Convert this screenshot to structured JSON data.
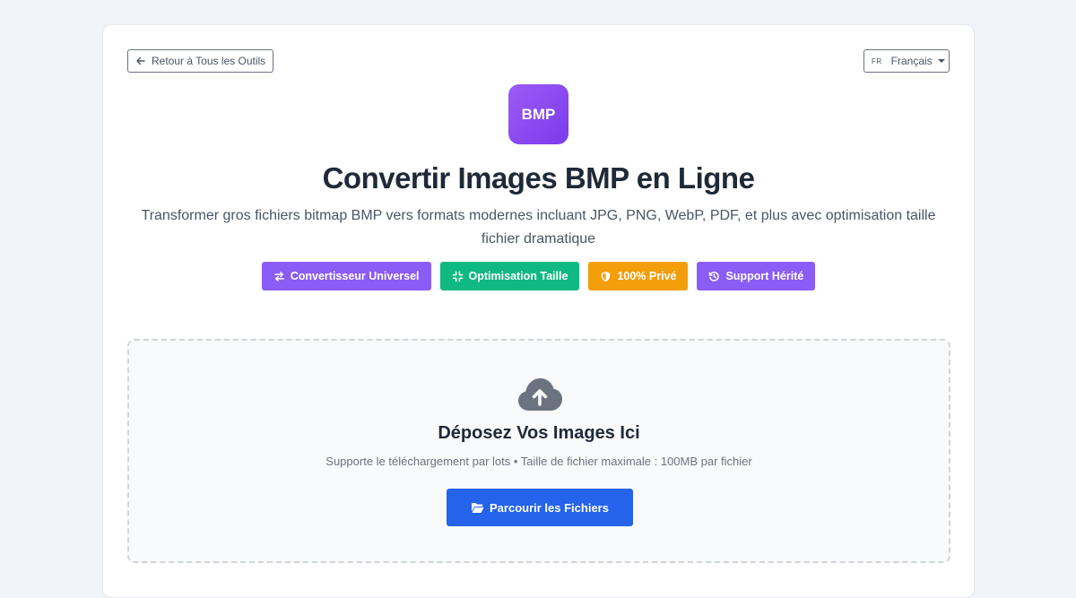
{
  "nav": {
    "back_label": "Retour à Tous les Outils",
    "language_code": "FR",
    "language_label": "Français"
  },
  "logo": {
    "text": "BMP",
    "color": "#8b5cf6"
  },
  "header": {
    "title": "Convertir Images BMP en Ligne",
    "subtitle": "Transformer gros fichiers bitmap BMP vers formats modernes incluant JPG, PNG, WebP, PDF, et plus avec optimisation taille fichier dramatique"
  },
  "badges": [
    {
      "label": "Convertisseur Universel",
      "icon": "exchange-icon",
      "color": "#8b5cf6"
    },
    {
      "label": "Optimisation Taille",
      "icon": "compress-icon",
      "color": "#10b981"
    },
    {
      "label": "100% Privé",
      "icon": "shield-icon",
      "color": "#f59e0b"
    },
    {
      "label": "Support Hérité",
      "icon": "history-icon",
      "color": "#8b5cf6"
    }
  ],
  "dropzone": {
    "icon": "cloud-upload-icon",
    "title": "Déposez Vos Images Ici",
    "subtitle": "Supporte le téléchargement par lots • Taille de fichier maximale : 100MB par fichier",
    "button_label": "Parcourir les Fichiers",
    "button_icon": "folder-open-icon",
    "button_color": "#2563eb"
  }
}
